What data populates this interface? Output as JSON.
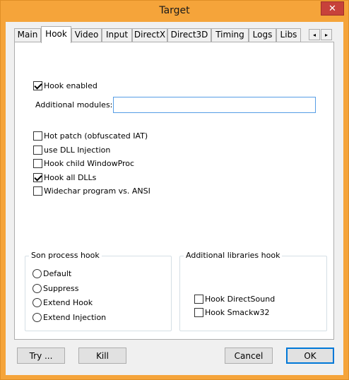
{
  "window": {
    "title": "Target",
    "close_label": "✕"
  },
  "tabs": [
    "Main",
    "Hook",
    "Video",
    "Input",
    "DirectX",
    "Direct3D",
    "Timing",
    "Logs",
    "Libs"
  ],
  "tab_scroll": {
    "left": "◂",
    "right": "▸"
  },
  "hook": {
    "hook_enabled": {
      "label": "Hook enabled",
      "checked": true
    },
    "additional_modules": {
      "label": "Additional modules:",
      "value": ""
    },
    "options": [
      {
        "label": "Hot patch (obfuscated IAT)",
        "checked": false
      },
      {
        "label": "use DLL Injection",
        "checked": false
      },
      {
        "label": "Hook child WindowProc",
        "checked": false
      },
      {
        "label": "Hook all DLLs",
        "checked": true
      },
      {
        "label": "Widechar program vs. ANSI",
        "checked": false
      }
    ],
    "son_process": {
      "title": "Son process hook",
      "options": [
        "Default",
        "Suppress",
        "Extend Hook",
        "Extend Injection"
      ]
    },
    "additional_libraries": {
      "title": "Additional libraries hook",
      "options": [
        {
          "label": "Hook DirectSound",
          "checked": false
        },
        {
          "label": "Hook Smackw32",
          "checked": false
        }
      ]
    }
  },
  "buttons": {
    "try": "Try ...",
    "kill": "Kill",
    "cancel": "Cancel",
    "ok": "OK"
  }
}
